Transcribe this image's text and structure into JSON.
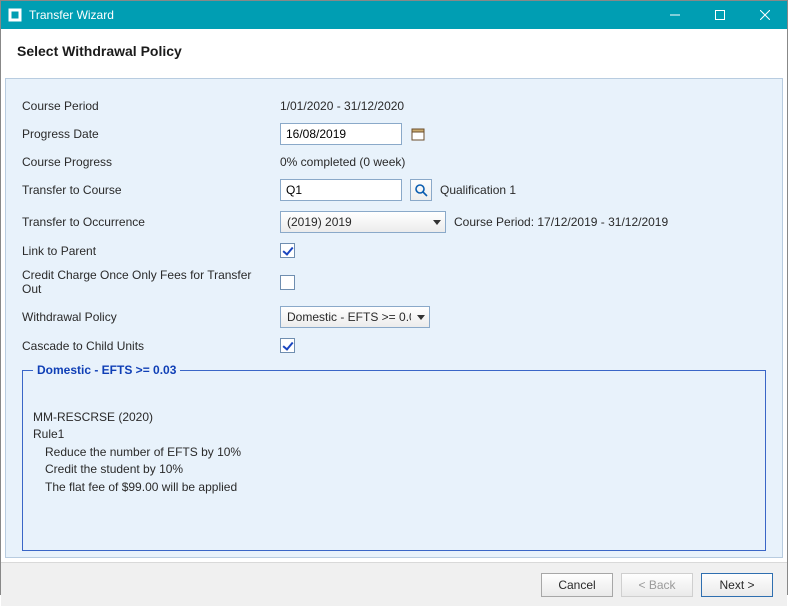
{
  "window": {
    "title": "Transfer Wizard"
  },
  "header": {
    "title": "Select Withdrawal Policy"
  },
  "form": {
    "course_period": {
      "label": "Course Period",
      "value": "1/01/2020 - 31/12/2020"
    },
    "progress_date": {
      "label": "Progress Date",
      "value": "16/08/2019"
    },
    "course_progress": {
      "label": "Course Progress",
      "value": "0% completed (0 week)"
    },
    "transfer_to_course": {
      "label": "Transfer to Course",
      "value": "Q1",
      "lookup_result": "Qualification 1"
    },
    "transfer_to_occurrence": {
      "label": "Transfer to Occurrence",
      "selected": "(2019) 2019",
      "side_text": "Course Period: 17/12/2019 - 31/12/2019"
    },
    "link_to_parent": {
      "label": "Link to Parent",
      "checked": true
    },
    "credit_charge_once": {
      "label": "Credit Charge Once Only Fees for Transfer Out",
      "checked": false
    },
    "withdrawal_policy": {
      "label": "Withdrawal Policy",
      "selected": "Domestic - EFTS >= 0.03"
    },
    "cascade_child": {
      "label": "Cascade to Child Units",
      "checked": true
    }
  },
  "policy_panel": {
    "legend": "Domestic - EFTS >= 0.03",
    "line1": "MM-RESCRSE (2020)",
    "line2": "Rule1",
    "line3": "Reduce the number of EFTS by 10%",
    "line4": "Credit the student by 10%",
    "line5": "The flat fee of $99.00 will be applied"
  },
  "footer": {
    "cancel": "Cancel",
    "back": "< Back",
    "next": "Next >"
  }
}
